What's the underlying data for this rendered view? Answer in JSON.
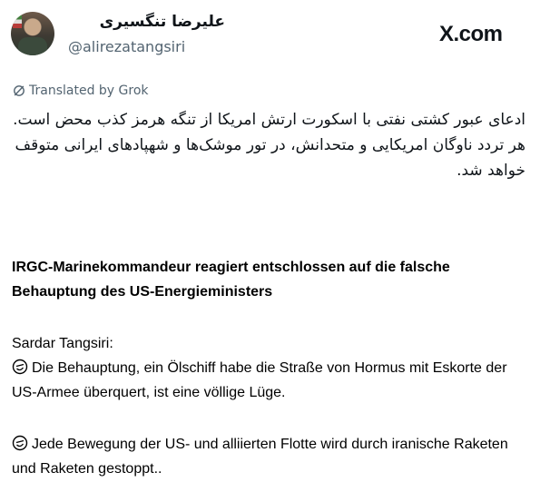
{
  "tweet": {
    "display_name": "علیرضا تنگسیری",
    "handle": "@alirezatangsiri",
    "translated_label": "Translated by Grok",
    "body_lines": [
      "ادعای عبور کشتی نفتی با اسکورت ارتش امریکا از تنگه هرمز کذب محض است.",
      "هر تردد ناوگان امریکایی و متحدانش، در تور موشک‌ها و شهپادهای ایرانی متوقف خواهد شد."
    ]
  },
  "brand": {
    "logo_text": "X.com"
  },
  "article": {
    "headline": "IRGC-Marinekommandeur reagiert entschlossen auf die falsche Behauptung des US-Energieministers",
    "speaker": "Sardar Tangsiri:",
    "points": [
      "Die Behauptung, ein Ölschiff habe die Straße von Hormus mit Eskorte der US-Armee überquert, ist eine völlige Lüge.",
      "Jede Bewegung der US- und alliierten Flotte wird durch iranische Raketen und Raketen gestoppt.."
    ]
  },
  "icons": {
    "avatar": "profile-photo",
    "translate": "grok-icon",
    "point_bullet": "smile-emoji"
  }
}
